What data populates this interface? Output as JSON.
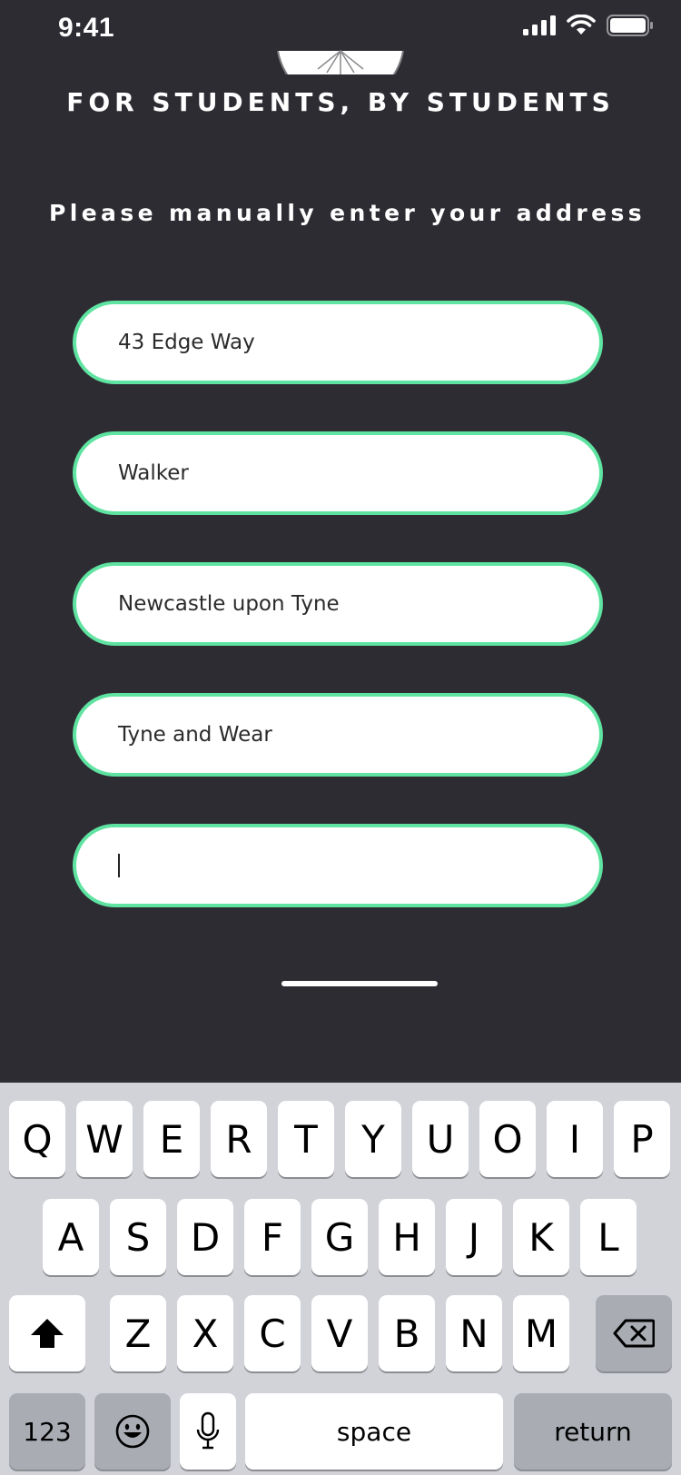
{
  "status_bar": {
    "time": "9:41"
  },
  "header": {
    "tagline": "FOR STUDENTS, BY STUDENTS"
  },
  "form": {
    "instruction": "Please manually enter your address",
    "fields": [
      {
        "value": "43 Edge Way"
      },
      {
        "value": "Walker"
      },
      {
        "value": "Newcastle upon Tyne"
      },
      {
        "value": "Tyne and Wear"
      },
      {
        "value": ""
      }
    ]
  },
  "keyboard": {
    "row1": [
      "Q",
      "W",
      "E",
      "R",
      "T",
      "Y",
      "U",
      "O",
      "I",
      "P"
    ],
    "row2": [
      "A",
      "S",
      "D",
      "F",
      "G",
      "H",
      "J",
      "K",
      "L"
    ],
    "row3": [
      "Z",
      "X",
      "C",
      "V",
      "B",
      "N",
      "M"
    ],
    "numbers_label": "123",
    "space_label": "space",
    "return_label": "return"
  },
  "colors": {
    "background": "#2e2c33",
    "field_border": "#5fe3a1",
    "keyboard_bg": "#d1d3d9"
  }
}
